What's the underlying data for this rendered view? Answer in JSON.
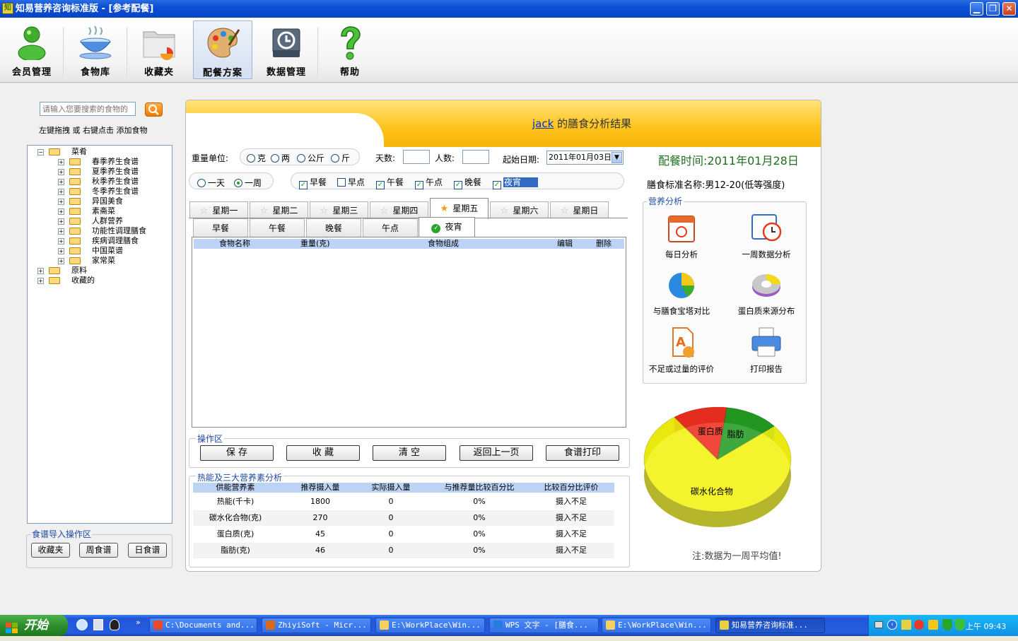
{
  "window": {
    "title": "知易营养咨询标准版 - [参考配餐]",
    "min": "▁",
    "max": "❐",
    "close": "✕"
  },
  "toolbar": [
    {
      "label": "会员管理",
      "icon": "member-user-icon"
    },
    {
      "label": "食物库",
      "icon": "food-bowl-icon"
    },
    {
      "label": "收藏夹",
      "icon": "favorites-folder-icon"
    },
    {
      "label": "配餐方案",
      "icon": "palette-icon"
    },
    {
      "label": "数据管理",
      "icon": "database-restore-icon"
    },
    {
      "label": "帮助",
      "icon": "help-question-icon"
    }
  ],
  "left": {
    "search_placeholder": "请输入您要搜索的食物的",
    "hint": "左键拖拽 或 右键点击 添加食物",
    "tree": [
      {
        "label": "菜肴",
        "level": 0,
        "expanded": true
      },
      {
        "label": "春季养生食谱",
        "level": 1
      },
      {
        "label": "夏季养生食谱",
        "level": 1
      },
      {
        "label": "秋季养生食谱",
        "level": 1
      },
      {
        "label": "冬季养生食谱",
        "level": 1
      },
      {
        "label": "异国美食",
        "level": 1
      },
      {
        "label": "素斋菜",
        "level": 1
      },
      {
        "label": "人群营养",
        "level": 1
      },
      {
        "label": "功能性调理膳食",
        "level": 1
      },
      {
        "label": "疾病调理膳食",
        "level": 1
      },
      {
        "label": "中国菜谱",
        "level": 1
      },
      {
        "label": "家常菜",
        "level": 1
      },
      {
        "label": "原料",
        "level": 0
      },
      {
        "label": "收藏的",
        "level": 0
      }
    ],
    "import_title": "食谱导入操作区",
    "import_buttons": [
      "收藏夹",
      "周食谱",
      "日食谱"
    ]
  },
  "header": {
    "user": "jack",
    "title_suffix": " 的膳食分析结果"
  },
  "controls": {
    "weight_label": "重量单位:",
    "weight_units": [
      "克",
      "两",
      "公斤",
      "斤"
    ],
    "days_label": "天数:",
    "days_value": "",
    "people_label": "人数:",
    "people_value": "",
    "start_date_label": "起始日期:",
    "start_date": "2011年01月03日",
    "period_options": [
      "一天",
      "一周"
    ],
    "meal_checks": [
      "早餐",
      "早点",
      "午餐",
      "午点",
      "晚餐",
      "夜宵"
    ]
  },
  "day_tabs": [
    "星期一",
    "星期二",
    "星期三",
    "星期四",
    "星期五",
    "星期六",
    "星期日"
  ],
  "meal_tabs": [
    "早餐",
    "午餐",
    "晚餐",
    "午点",
    "夜宵"
  ],
  "grid_headers": [
    "食物名称",
    "重量(克)",
    "食物组成",
    "编辑",
    "删除"
  ],
  "ops": {
    "title": "操作区",
    "buttons": [
      "保 存",
      "收 藏",
      "清 空",
      "返回上一页",
      "食谱打印"
    ]
  },
  "analysis": {
    "title": "热能及三大营养素分析",
    "headers": [
      "供能营养素",
      "推荐摄入量",
      "实际摄入量",
      "与推荐量比较百分比",
      "比较百分比评价"
    ],
    "rows": [
      [
        "热能(千卡)",
        "1800",
        "0",
        "0%",
        "摄入不足"
      ],
      [
        "碳水化合物(克)",
        "270",
        "0",
        "0%",
        "摄入不足"
      ],
      [
        "蛋白质(克)",
        "45",
        "0",
        "0%",
        "摄入不足"
      ],
      [
        "脂肪(克)",
        "46",
        "0",
        "0%",
        "摄入不足"
      ]
    ]
  },
  "right": {
    "plan_time": "配餐时间:2011年01月28日",
    "standard": "膳食标准名称:男12-20(低等强度)",
    "nutrition_title": "营养分析",
    "items": [
      "每日分析",
      "一周数据分析",
      "与膳食宝塔对比",
      "蛋白质来源分布",
      "不足或过量的评价",
      "打印报告"
    ],
    "note": "注:数据为一周平均值!"
  },
  "chart_data": {
    "type": "pie",
    "labels": [
      "碳水化合物",
      "蛋白质",
      "脂肪"
    ],
    "values": [
      76,
      12,
      12
    ],
    "colors": [
      "#f2f20a",
      "#ee2a1a",
      "#1e9a1e"
    ]
  },
  "taskbar": {
    "start": "开始",
    "tasks": [
      "C:\\Documents and...",
      "ZhiyiSoft - Micr...",
      "E:\\WorkPlace\\Win...",
      "WPS 文字 - [膳食...",
      "E:\\WorkPlace\\Win...",
      "知易营养咨询标准..."
    ],
    "clock": "上午 09:43"
  }
}
